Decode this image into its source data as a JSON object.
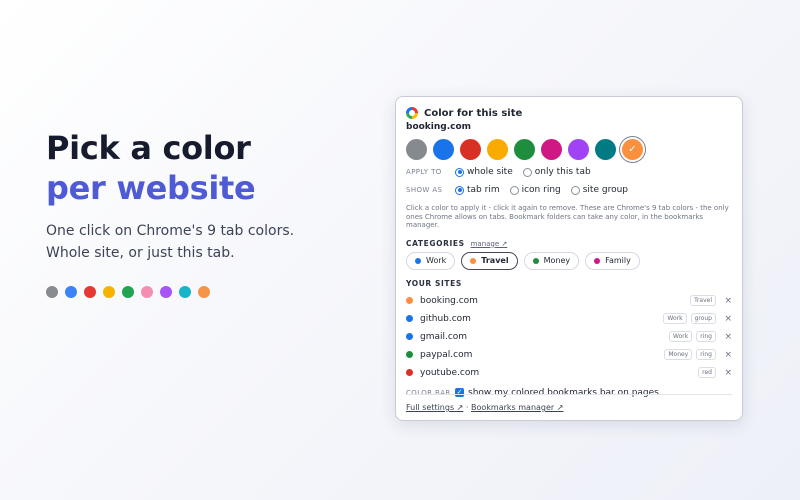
{
  "hero": {
    "title_line1": "Pick a color",
    "title_line2": "per website",
    "subtitle_line1": "One click on Chrome's 9 tab colors.",
    "subtitle_line2": "Whole site, or just this tab.",
    "dots": [
      "#888b8f",
      "#3b82f6",
      "#e53935",
      "#f5b400",
      "#22a352",
      "#f48fb1",
      "#a855f7",
      "#17b3c9",
      "#f59547"
    ]
  },
  "popup": {
    "title": "Color for this site",
    "domain": "booking.com",
    "swatches": [
      "#868a8f",
      "#1a73e8",
      "#d93025",
      "#f9ab00",
      "#1e8e3e",
      "#d01884",
      "#a142f4",
      "#007b83",
      "#fa903e"
    ],
    "selected_swatch_mark": "✓",
    "apply_to": {
      "label": "APPLY TO",
      "options": [
        "whole site",
        "only this tab"
      ],
      "selected": "whole site"
    },
    "show_as": {
      "label": "SHOW AS",
      "options": [
        "tab rim",
        "icon ring",
        "site group"
      ],
      "selected": "tab rim"
    },
    "help": "Click a color to apply it - click it again to remove. These are Chrome's 9 tab colors - the only ones Chrome allows on tabs. Bookmark folders can take any color, in the bookmarks manager.",
    "categories": {
      "label": "CATEGORIES",
      "manage": "manage ↗",
      "items": [
        {
          "label": "Work",
          "color": "#1a73e8"
        },
        {
          "label": "Travel",
          "color": "#fa903e",
          "selected": true
        },
        {
          "label": "Money",
          "color": "#1e8e3e"
        },
        {
          "label": "Family",
          "color": "#d01884"
        }
      ]
    },
    "your_sites": {
      "label": "YOUR SITES",
      "items": [
        {
          "name": "booking.com",
          "color": "#fa903e",
          "tags": [
            "Travel"
          ]
        },
        {
          "name": "github.com",
          "color": "#1a73e8",
          "tags": [
            "Work",
            "group"
          ]
        },
        {
          "name": "gmail.com",
          "color": "#1a73e8",
          "tags": [
            "Work",
            "ring"
          ]
        },
        {
          "name": "paypal.com",
          "color": "#1e8e3e",
          "tags": [
            "Money",
            "ring"
          ]
        },
        {
          "name": "youtube.com",
          "color": "#d93025",
          "tags": [
            "red"
          ]
        }
      ],
      "remove_glyph": "×"
    },
    "color_bar": {
      "label": "COLOR BAR",
      "text": "show my colored bookmarks bar on pages",
      "checked": true
    },
    "footer": {
      "full_settings": "Full settings ↗",
      "separator": "·",
      "bookmarks_manager": "Bookmarks manager ↗"
    }
  }
}
